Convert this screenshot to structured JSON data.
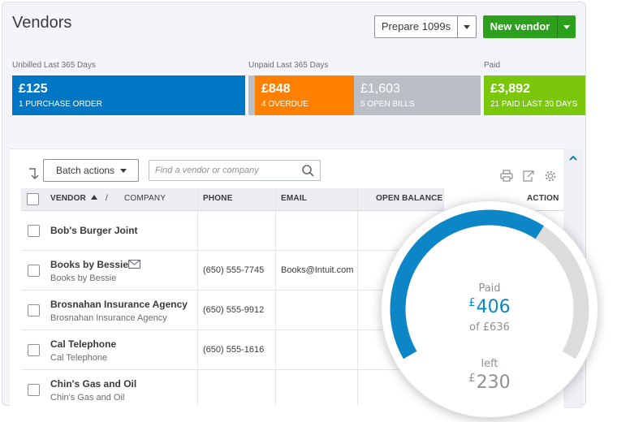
{
  "header": {
    "title": "Vendors",
    "prepare_label": "Prepare 1099s",
    "new_vendor_label": "New vendor"
  },
  "summary": {
    "unbilled_label": "Unbilled Last 365 Days",
    "unpaid_label": "Unpaid Last 365 Days",
    "paid_label": "Paid",
    "tiles": [
      {
        "amount": "£125",
        "caption": "1 PURCHASE ORDER",
        "color": "#0077c5"
      },
      {
        "amount": "£848",
        "caption": "4 OVERDUE",
        "color": "#ff8000"
      },
      {
        "amount": "£1,603",
        "caption": "5 OPEN BILLS",
        "color": "#babec5"
      },
      {
        "amount": "£3,892",
        "caption": "21 PAID LAST 30 DAYS",
        "color": "#7ac70c"
      }
    ]
  },
  "toolbar": {
    "batch_label": "Batch actions",
    "search_placeholder": "Find a vendor or company"
  },
  "table": {
    "columns": {
      "vendor": "VENDOR",
      "sep": "/",
      "company": "COMPANY",
      "phone": "PHONE",
      "email": "EMAIL",
      "open_balance": "OPEN BALANCE",
      "action": "ACTION"
    },
    "rows": [
      {
        "name": "Bob's Burger Joint",
        "company": "",
        "phone": "",
        "email": ""
      },
      {
        "name": "Books by Bessie",
        "company": "Books by Bessie",
        "phone": "(650) 555-7745",
        "email": "Books@Intuit.com"
      },
      {
        "name": "Brosnahan Insurance Agency",
        "company": "Brosnahan Insurance Agency",
        "phone": "(650) 555-9912",
        "email": ""
      },
      {
        "name": "Cal Telephone",
        "company": "Cal Telephone",
        "phone": "(650) 555-1616",
        "email": ""
      },
      {
        "name": "Chin's Gas and Oil",
        "company": "Chin's Gas and Oil",
        "phone": "",
        "email": ""
      }
    ]
  },
  "gauge": {
    "paid_label": "Paid",
    "currency": "£",
    "paid_value": "406",
    "of_text": "of £636",
    "left_label": "left",
    "left_value": "230",
    "paid_fraction": 0.638,
    "paid_color": "#0d86c8",
    "track_color": "#dcdcdc"
  }
}
